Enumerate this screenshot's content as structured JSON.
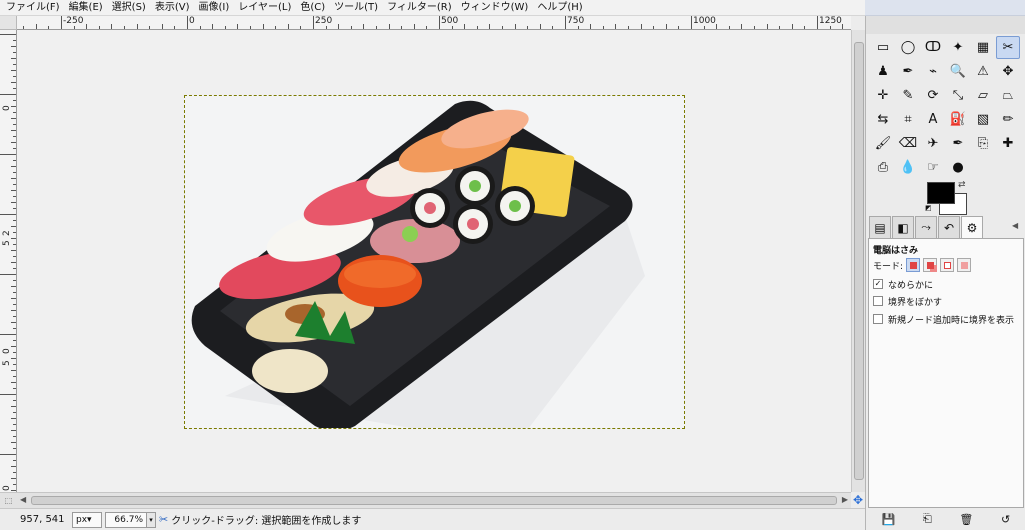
{
  "menu": [
    "ファイル(F)",
    "編集(E)",
    "選択(S)",
    "表示(V)",
    "画像(I)",
    "レイヤー(L)",
    "色(C)",
    "ツール(T)",
    "フィルター(R)",
    "ウィンドウ(W)",
    "ヘルプ(H)"
  ],
  "ruler": {
    "h_labels": [
      "-250",
      "0",
      "250",
      "500",
      "750",
      "1000",
      "1250"
    ],
    "v_labels": [
      "0",
      "2",
      "5",
      "0",
      "5",
      "0"
    ]
  },
  "status": {
    "coords": "957, 541",
    "unit": "px",
    "zoom": "66.7%",
    "message": "クリック-ドラッグ: 選択範囲を作成します"
  },
  "toolbox": {
    "tools": [
      {
        "name": "rect-select-icon",
        "glyph": "▭"
      },
      {
        "name": "ellipse-select-icon",
        "glyph": "◯"
      },
      {
        "name": "free-select-icon",
        "glyph": "ↀ"
      },
      {
        "name": "fuzzy-select-icon",
        "glyph": "✦"
      },
      {
        "name": "color-select-icon",
        "glyph": "▦"
      },
      {
        "name": "scissors-select-icon",
        "glyph": "✂"
      },
      {
        "name": "foreground-select-icon",
        "glyph": "♟"
      },
      {
        "name": "paths-icon",
        "glyph": "✒"
      },
      {
        "name": "color-picker-icon",
        "glyph": "⌁"
      },
      {
        "name": "zoom-icon",
        "glyph": "🔍"
      },
      {
        "name": "measure-icon",
        "glyph": "⚠"
      },
      {
        "name": "move-icon",
        "glyph": "✥"
      },
      {
        "name": "align-icon",
        "glyph": "✛"
      },
      {
        "name": "crop-icon",
        "glyph": "✎"
      },
      {
        "name": "rotate-icon",
        "glyph": "⟳"
      },
      {
        "name": "scale-icon",
        "glyph": "⤡"
      },
      {
        "name": "shear-icon",
        "glyph": "▱"
      },
      {
        "name": "perspective-icon",
        "glyph": "⏢"
      },
      {
        "name": "flip-icon",
        "glyph": "⇆"
      },
      {
        "name": "cage-icon",
        "glyph": "⌗"
      },
      {
        "name": "text-icon",
        "glyph": "A"
      },
      {
        "name": "bucket-fill-icon",
        "glyph": "⛽"
      },
      {
        "name": "blend-icon",
        "glyph": "▧"
      },
      {
        "name": "pencil-icon",
        "glyph": "✏"
      },
      {
        "name": "paintbrush-icon",
        "glyph": "🖌"
      },
      {
        "name": "eraser-icon",
        "glyph": "⌫"
      },
      {
        "name": "airbrush-icon",
        "glyph": "✈"
      },
      {
        "name": "ink-icon",
        "glyph": "✒"
      },
      {
        "name": "clone-icon",
        "glyph": "⎘"
      },
      {
        "name": "heal-icon",
        "glyph": "✚"
      },
      {
        "name": "perspective-clone-icon",
        "glyph": "⎙"
      },
      {
        "name": "blur-icon",
        "glyph": "💧"
      },
      {
        "name": "smudge-icon",
        "glyph": "☞"
      },
      {
        "name": "dodge-burn-icon",
        "glyph": "●"
      }
    ],
    "active_tool_index": 5
  },
  "colors": {
    "foreground": "#000000",
    "background": "#ffffff",
    "accent": "#7a9cd3"
  },
  "dock": {
    "tabs": [
      {
        "name": "tab-layers-icon",
        "glyph": "▤"
      },
      {
        "name": "tab-channels-icon",
        "glyph": "◧"
      },
      {
        "name": "tab-paths-icon",
        "glyph": "⤳"
      },
      {
        "name": "tab-undo-icon",
        "glyph": "↶"
      },
      {
        "name": "tab-tool-options-icon",
        "glyph": "⚙"
      }
    ],
    "active_tab_index": 4
  },
  "tool_options": {
    "title": "電脳はさみ",
    "mode_label": "モード:",
    "antialias": {
      "label": "なめらかに",
      "checked": true
    },
    "feather": {
      "label": "境界をぼかす",
      "checked": false
    },
    "interactive": {
      "label": "新規ノード追加時に境界を表示",
      "checked": false
    }
  },
  "dock_bottom_buttons": [
    {
      "name": "save-options-icon",
      "glyph": "💾"
    },
    {
      "name": "restore-options-icon",
      "glyph": "⎗"
    },
    {
      "name": "delete-options-icon",
      "glyph": "🗑"
    },
    {
      "name": "reset-options-icon",
      "glyph": "↺"
    }
  ]
}
